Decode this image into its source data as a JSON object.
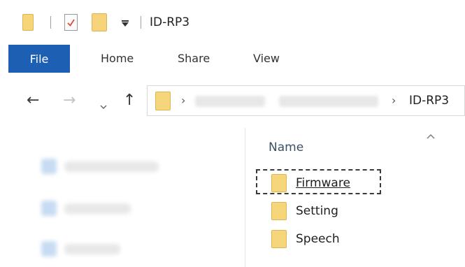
{
  "window": {
    "title": "ID-RP3",
    "qat_icons": [
      "folder-icon",
      "properties-icon",
      "new-folder-icon",
      "customize-qat-icon"
    ]
  },
  "ribbon": {
    "tabs": [
      {
        "label": "File",
        "active": true
      },
      {
        "label": "Home"
      },
      {
        "label": "Share"
      },
      {
        "label": "View"
      }
    ]
  },
  "address_bar": {
    "nav_icons": [
      "back-arrow-icon",
      "forward-arrow-icon",
      "recent-locations-icon",
      "up-arrow-icon"
    ],
    "current": "ID-RP3",
    "separator": "›"
  },
  "file_list": {
    "column_header": "Name",
    "sort_indicator": "^",
    "items": [
      {
        "name": "Firmware",
        "highlighted": true
      },
      {
        "name": "Setting"
      },
      {
        "name": "Speech"
      }
    ]
  },
  "colors": {
    "accent": "#1c5fb3",
    "folder": "#f6d67a"
  }
}
